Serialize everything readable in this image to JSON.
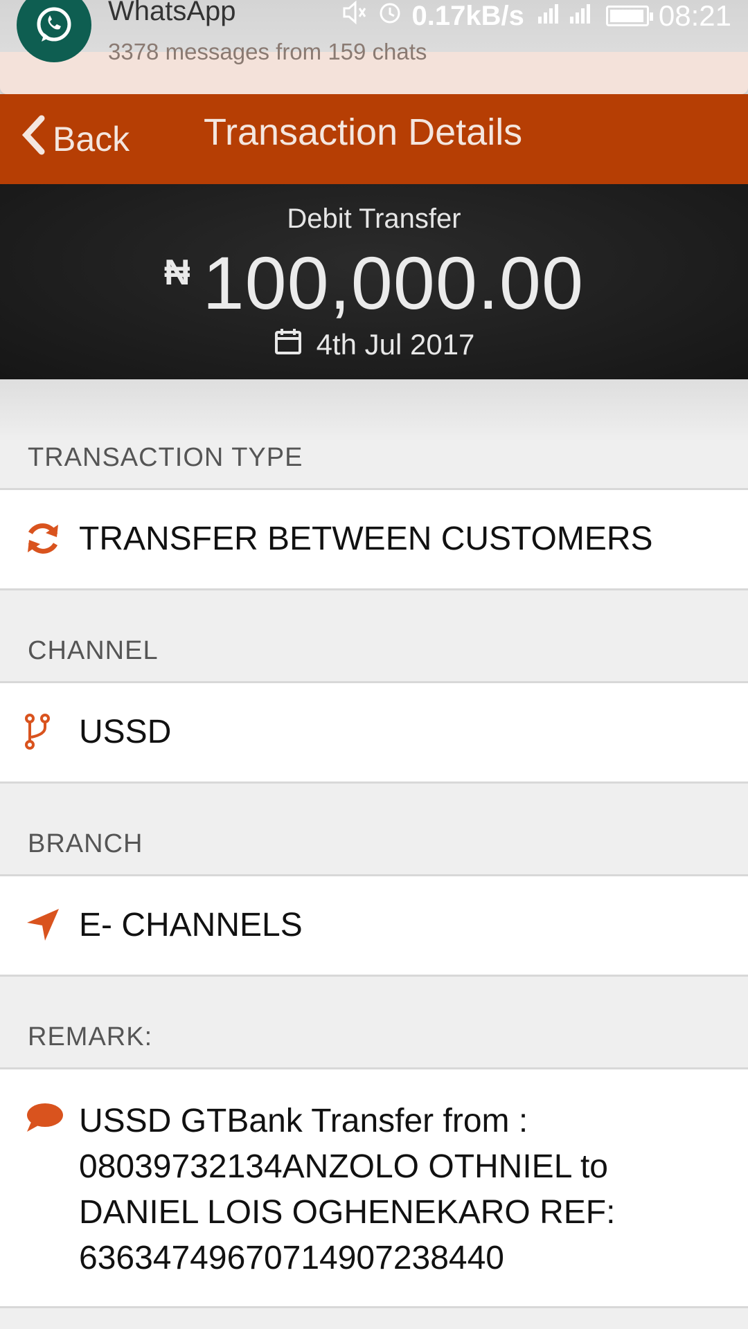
{
  "notification": {
    "app": "WhatsApp",
    "summary": "3378 messages from 159 chats"
  },
  "status": {
    "speed": "0.17kB/s",
    "time": "08:21"
  },
  "header": {
    "back_label": "Back",
    "title": "Transaction Details"
  },
  "summary": {
    "type": "Debit Transfer",
    "currency": "₦",
    "amount": "100,000.00",
    "date": "4th Jul 2017"
  },
  "sections": {
    "transaction_type": {
      "label": "TRANSACTION TYPE",
      "value": "TRANSFER BETWEEN CUSTOMERS"
    },
    "channel": {
      "label": "CHANNEL",
      "value": "USSD"
    },
    "branch": {
      "label": "BRANCH",
      "value": "E- CHANNELS"
    },
    "remark": {
      "label": "REMARK:",
      "value": "USSD GTBank Transfer from : 08039732134ANZOLO OTHNIEL to DANIEL LOIS OGHENEKARO REF: 636347496707149072384​40"
    }
  },
  "colors": {
    "accent": "#b63e04",
    "icon": "#d9531e"
  }
}
